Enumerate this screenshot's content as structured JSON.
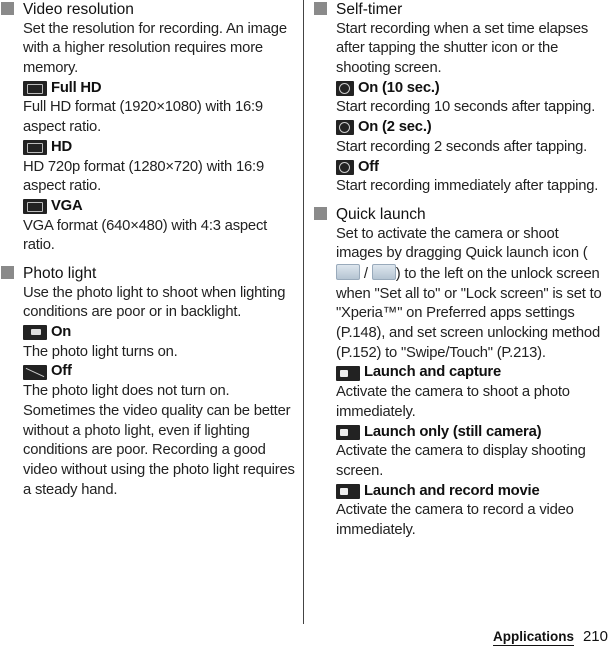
{
  "left": {
    "video_resolution": {
      "title": "Video resolution",
      "desc": "Set the resolution for recording. An image with a higher resolution requires more memory.",
      "options": [
        {
          "icon": "full-hd-icon",
          "label": "Full HD",
          "desc": "Full HD format (1920×1080) with 16:9 aspect ratio."
        },
        {
          "icon": "hd-icon",
          "label": "HD",
          "desc": "HD 720p format (1280×720) with 16:9 aspect ratio."
        },
        {
          "icon": "vga-icon",
          "label": "VGA",
          "desc": "VGA format (640×480) with 4:3 aspect ratio."
        }
      ]
    },
    "photo_light": {
      "title": "Photo light",
      "desc": "Use the photo light to shoot when lighting conditions are poor or in backlight.",
      "options": [
        {
          "icon": "photo-light-on-icon",
          "label": "On",
          "desc": "The photo light turns on."
        },
        {
          "icon": "photo-light-off-icon",
          "label": "Off",
          "desc": "The photo light does not turn on. Sometimes the video quality can be better without a photo light, even if lighting conditions are poor. Recording a good video without using the photo light requires a steady hand."
        }
      ]
    }
  },
  "right": {
    "self_timer": {
      "title": "Self-timer",
      "desc": "Start recording when a set time elapses after tapping the shutter icon or the shooting screen.",
      "options": [
        {
          "icon": "timer-10-icon",
          "label": "On (10 sec.)",
          "desc": "Start recording 10 seconds after tapping."
        },
        {
          "icon": "timer-2-icon",
          "label": "On (2 sec.)",
          "desc": "Start recording 2 seconds after tapping."
        },
        {
          "icon": "timer-off-icon",
          "label": "Off",
          "desc": "Start recording immediately after tapping."
        }
      ]
    },
    "quick_launch": {
      "title": "Quick launch",
      "desc_part1": "Set to activate the camera or shoot images by dragging Quick launch icon (",
      "desc_sep": " / ",
      "desc_part2": ") to the left on the unlock screen when \"Set all to\" or \"Lock screen\" is set to \"Xperia™\" on Preferred apps settings (P.148), and set screen unlocking method (P.152) to \"Swipe/Touch\" (P.213).",
      "options": [
        {
          "icon": "launch-capture-icon",
          "label": "Launch and capture",
          "desc": "Activate the camera to shoot a photo immediately."
        },
        {
          "icon": "launch-only-icon",
          "label": "Launch only (still camera)",
          "desc": "Activate the camera to display shooting screen."
        },
        {
          "icon": "launch-record-icon",
          "label": "Launch and record movie",
          "desc": "Activate the camera to record a video immediately."
        }
      ]
    }
  },
  "footer": {
    "section": "Applications",
    "page": "210"
  }
}
